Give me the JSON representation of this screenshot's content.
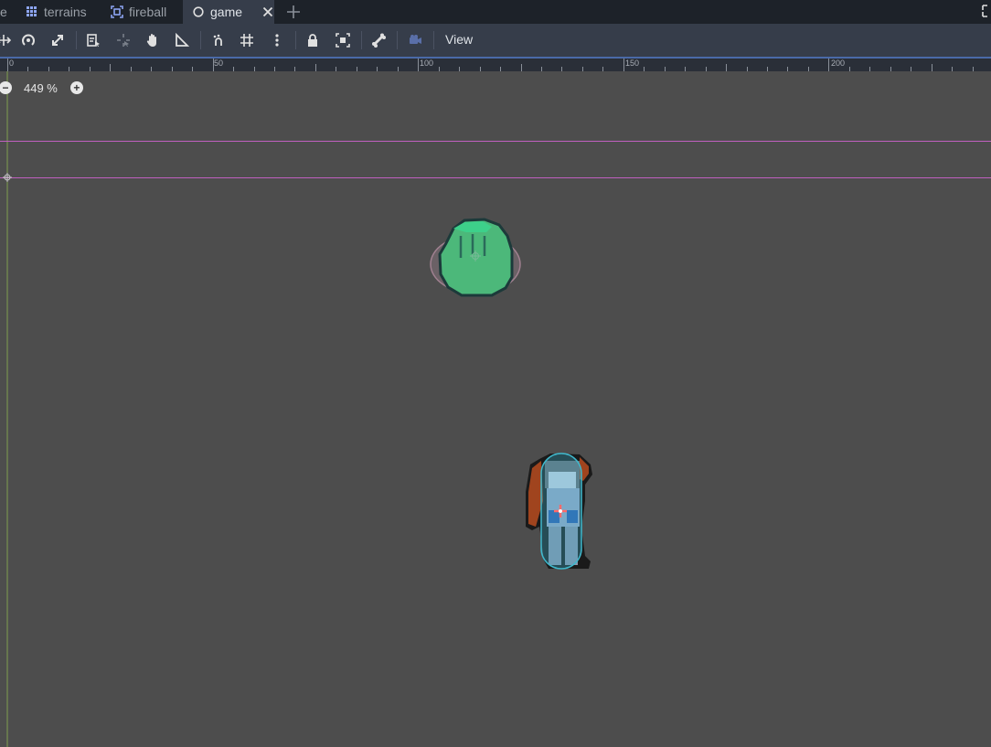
{
  "tabs": [
    {
      "label": "e",
      "icon": "scene-icon"
    },
    {
      "label": "terrains",
      "icon": "tileset-grid-icon"
    },
    {
      "label": "fireball",
      "icon": "area-node-icon"
    },
    {
      "label": "game",
      "icon": "node-circle-icon",
      "active": true
    }
  ],
  "toolbar": {
    "view_label": "View"
  },
  "ruler": {
    "labels": [
      "0",
      "50",
      "100",
      "150",
      "200"
    ]
  },
  "viewport": {
    "zoom_label": "449 %",
    "zoom_out_symbol": "−",
    "zoom_in_symbol": "+"
  },
  "colors": {
    "tabbar_bg": "#1d2229",
    "toolbar_bg": "#363d4a",
    "canvas_bg": "#4d4d4d",
    "guide_line": "#c060c0",
    "origin_line": "#7fa050",
    "slime_green": "#4cb87a",
    "collision_cyan": "#40b0c8"
  }
}
